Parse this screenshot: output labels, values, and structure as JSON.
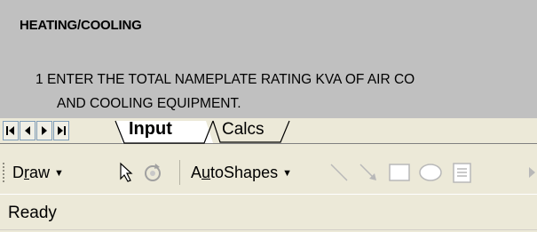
{
  "sheet": {
    "heading": "HEATING/COOLING",
    "item_number": "1",
    "item_line1": "ENTER THE TOTAL NAMEPLATE RATING KVA OF AIR CO",
    "item_line2": "AND COOLING EQUIPMENT."
  },
  "sheet_tabs": {
    "nav_buttons": [
      "first-sheet",
      "previous-sheet",
      "next-sheet",
      "last-sheet"
    ],
    "tabs": [
      {
        "label": "Input",
        "active": true
      },
      {
        "label": "Calcs",
        "active": false
      }
    ]
  },
  "drawing_toolbar": {
    "draw_label_prefix": "D",
    "draw_label_underlined": "r",
    "draw_label_suffix": "aw",
    "autoshapes_label_prefix": "A",
    "autoshapes_label_underlined": "u",
    "autoshapes_label_suffix": "toShapes",
    "dropdown_glyph": "▼",
    "icons": [
      "select-objects-icon",
      "free-rotate-icon",
      "line-icon",
      "arrow-icon",
      "rectangle-icon",
      "oval-icon",
      "text-box-icon"
    ]
  },
  "status_bar": {
    "status": "Ready"
  }
}
